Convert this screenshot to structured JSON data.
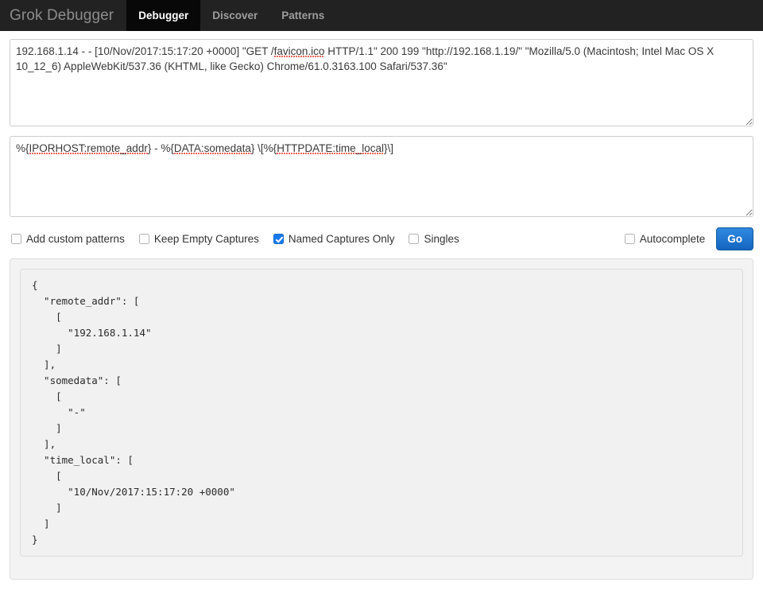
{
  "header": {
    "brand": "Grok Debugger",
    "tabs": [
      {
        "label": "Debugger",
        "active": true
      },
      {
        "label": "Discover",
        "active": false
      },
      {
        "label": "Patterns",
        "active": false
      }
    ]
  },
  "input": {
    "value": "192.168.1.14 - - [10/Nov/2017:15:17:20 +0000] \"GET /favicon.ico HTTP/1.1\" 200 199 \"http://192.168.1.19/\" \"Mozilla/5.0 (Macintosh; Intel Mac OS X 10_12_6) AppleWebKit/537.36 (KHTML, like Gecko) Chrome/61.0.3163.100 Safari/537.36\"",
    "placeholder": "",
    "spellcheck_words": [
      "favicon.ico"
    ]
  },
  "pattern": {
    "value": "%{IPORHOST:remote_addr} - %{DATA:somedata} \\[%{HTTPDATE:time_local}\\]",
    "placeholder": "",
    "spellcheck_words": [
      "IPORHOST:remote_addr",
      "DATA:somedata",
      "HTTPDATE:time_local"
    ]
  },
  "options": [
    {
      "label": "Add custom patterns",
      "checked": false
    },
    {
      "label": "Keep Empty Captures",
      "checked": false
    },
    {
      "label": "Named Captures Only",
      "checked": true
    },
    {
      "label": "Singles",
      "checked": false
    }
  ],
  "autocomplete": {
    "label": "Autocomplete",
    "checked": false
  },
  "go_button": {
    "label": "Go"
  },
  "output": {
    "text": "{\n  \"remote_addr\": [\n    [\n      \"192.168.1.14\"\n    ]\n  ],\n  \"somedata\": [\n    [\n      \"-\"\n    ]\n  ],\n  \"time_local\": [\n    [\n      \"10/Nov/2017:15:17:20 +0000\"\n    ]\n  ]\n}",
    "captures": {
      "remote_addr": "192.168.1.14",
      "somedata": "-",
      "time_local": "10/Nov/2017:15:17:20 +0000"
    }
  },
  "colors": {
    "navbar_bg": "#222222",
    "navbar_active_bg": "#080808",
    "accent_blue": "#1565c0",
    "checkbox_checked": "#1a7aeb",
    "spellcheck_red": "#e8584a"
  }
}
